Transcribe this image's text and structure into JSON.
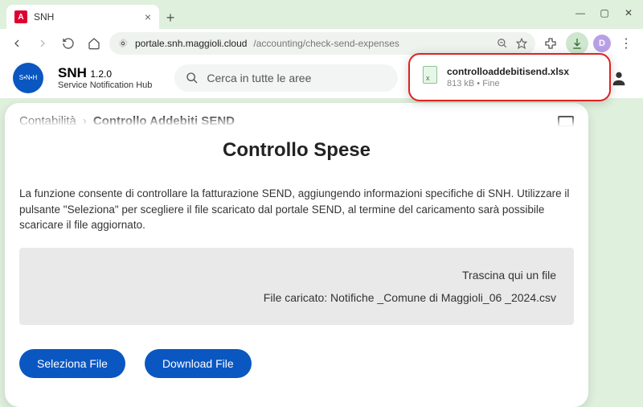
{
  "browser": {
    "tab": {
      "title": "SNH",
      "favicon_letter": "A"
    },
    "url_domain": "portale.snh.maggioli.cloud",
    "url_path": "/accounting/check-send-expenses",
    "avatar_letter": "D"
  },
  "download": {
    "filename": "controlloaddebitisend.xlsx",
    "meta": "813 kB • Fine"
  },
  "app": {
    "name": "SNH",
    "version": "1.2.0",
    "subtitle": "Service Notification Hub",
    "search_placeholder": "Cerca in tutte le aree",
    "logo_text": "SERVICE NOTIFICATION HUB"
  },
  "breadcrumb": {
    "item1": "Contabilità",
    "sep": "›",
    "item2": "Controllo Addebiti SEND"
  },
  "page": {
    "title": "Controllo Spese",
    "description": "La funzione consente di controllare la fatturazione SEND, aggiungendo informazioni specifiche di SNH. Utilizzare il pulsante \"Seleziona\" per scegliere il file scaricato dal portale SEND, al termine del caricamento sarà possibile scaricare il file aggiornato.",
    "dropzone_hint": "Trascina qui un file",
    "uploaded_label": "File caricato: Notifiche _Comune di Maggioli_06 _2024.csv",
    "btn_select": "Seleziona File",
    "btn_download": "Download File"
  }
}
